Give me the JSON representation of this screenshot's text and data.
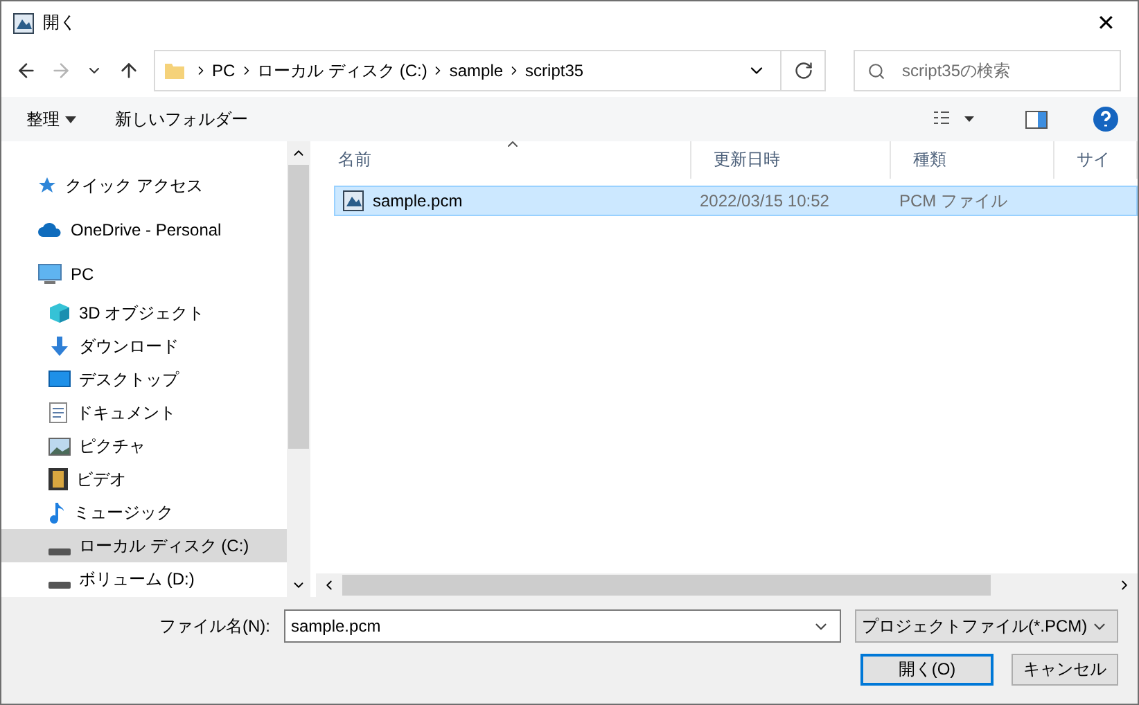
{
  "window": {
    "title": "開く",
    "close": "✕"
  },
  "nav": {
    "breadcrumb": [
      "PC",
      "ローカル ディスク (C:)",
      "sample",
      "script35"
    ],
    "search": {
      "placeholder": "script35の検索"
    }
  },
  "command_bar": {
    "organize": "整理",
    "new_folder": "新しいフォルダー"
  },
  "sidebar": {
    "items": [
      {
        "label": "クイック アクセス",
        "kind": "star",
        "selected": false
      },
      {
        "label": "OneDrive - Personal",
        "kind": "cloud",
        "selected": false
      },
      {
        "label": "PC",
        "kind": "monitor",
        "selected": false,
        "children": [
          {
            "label": "3D オブジェクト",
            "kind": "cube",
            "selected": false
          },
          {
            "label": "ダウンロード",
            "kind": "download",
            "selected": false
          },
          {
            "label": "デスクトップ",
            "kind": "desktop",
            "selected": false
          },
          {
            "label": "ドキュメント",
            "kind": "document",
            "selected": false
          },
          {
            "label": "ピクチャ",
            "kind": "picture",
            "selected": false
          },
          {
            "label": "ビデオ",
            "kind": "video",
            "selected": false
          },
          {
            "label": "ミュージック",
            "kind": "music",
            "selected": false
          },
          {
            "label": "ローカル ディスク (C:)",
            "kind": "drive",
            "selected": true
          },
          {
            "label": "ボリューム (D:)",
            "kind": "drive",
            "selected": false
          }
        ]
      }
    ]
  },
  "table": {
    "columns": [
      {
        "label": "名前",
        "sorted": true
      },
      {
        "label": "更新日時"
      },
      {
        "label": "種類"
      },
      {
        "label": "サイ"
      }
    ],
    "rows": [
      {
        "cells": [
          "sample.pcm",
          "2022/03/15 10:52",
          "PCM ファイル"
        ],
        "selected": true
      }
    ]
  },
  "footer": {
    "filename_label": "ファイル名(N):",
    "filename": "sample.pcm",
    "file_type": "プロジェクトファイル(*.PCM)",
    "buttons": [
      {
        "label": "開く(O)",
        "default": true
      },
      {
        "label": "キャンセル",
        "default": false
      }
    ]
  }
}
